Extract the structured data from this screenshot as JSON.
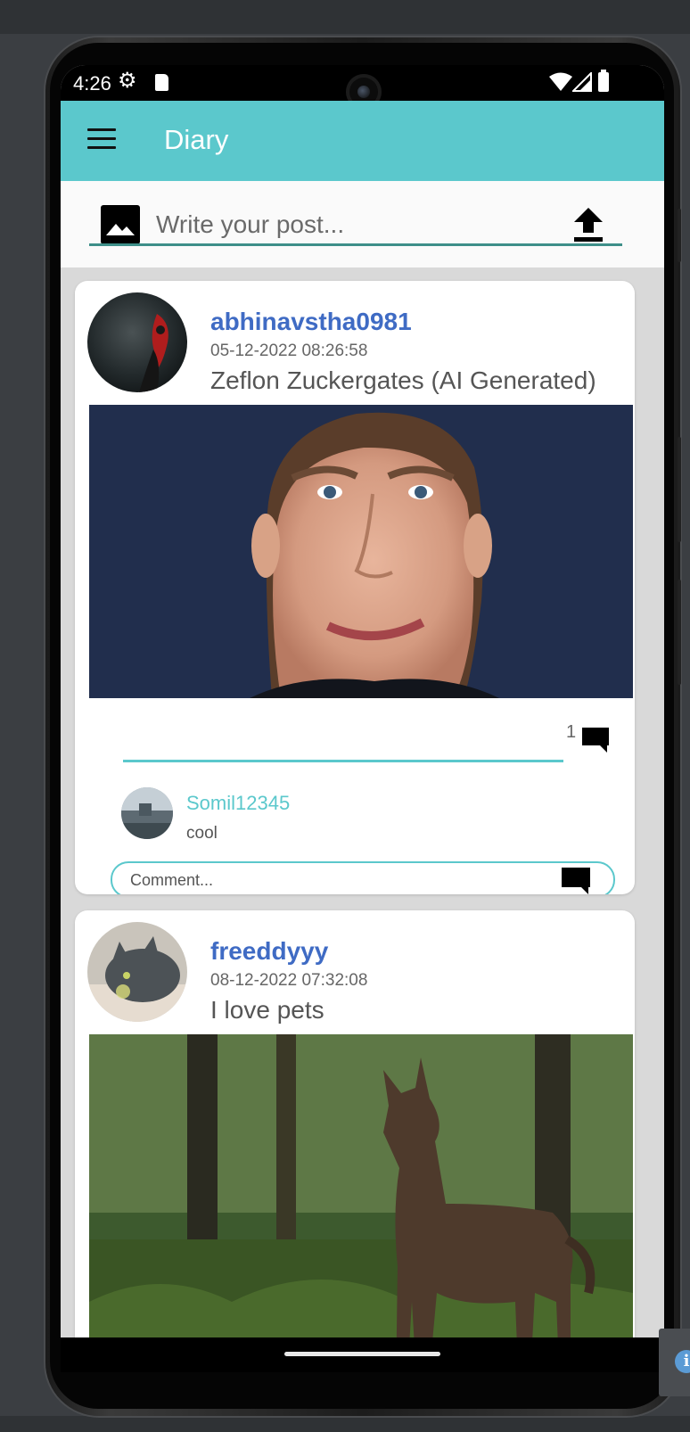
{
  "status_bar": {
    "time": "4:26",
    "icons": [
      "settings-gear-icon",
      "sd-card-icon",
      "wifi-icon",
      "cell-signal-icon",
      "battery-icon"
    ]
  },
  "app_bar": {
    "title": "Diary",
    "menu_icon": "hamburger-menu-icon"
  },
  "composer": {
    "placeholder": "Write your post...",
    "image_icon": "image-icon",
    "upload_icon": "upload-icon"
  },
  "posts": [
    {
      "author": "abhinavstha0981",
      "timestamp": "05-12-2022 08:26:58",
      "text": "Zeflon Zuckergates (AI Generated)",
      "comment_count": "1",
      "comments": [
        {
          "user": "Somil12345",
          "text": "cool"
        }
      ],
      "comment_placeholder": "Comment..."
    },
    {
      "author": "freeddyyy",
      "timestamp": "08-12-2022 07:32:08",
      "text": "I love pets"
    }
  ],
  "colors": {
    "accent": "#5bc8cc",
    "username": "#3f6bc4",
    "input_underline": "#3e8f89"
  }
}
